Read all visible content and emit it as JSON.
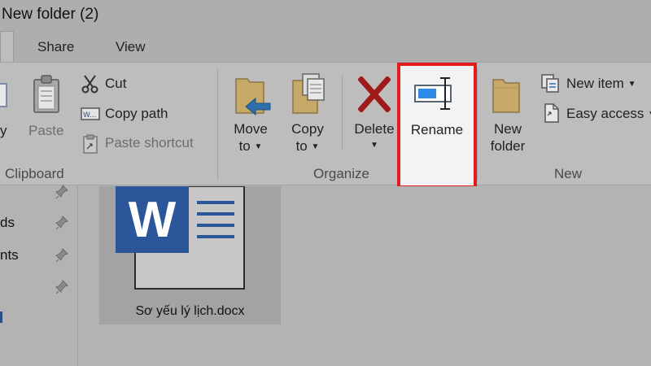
{
  "window": {
    "title": "New folder (2)"
  },
  "tabs": [
    {
      "label": "Share"
    },
    {
      "label": "View"
    }
  ],
  "ribbon": {
    "clipboard": {
      "group_label": "Clipboard",
      "partial_label": "y",
      "paste_label": "Paste",
      "cut_label": "Cut",
      "copy_path_label": "Copy path",
      "paste_shortcut_label": "Paste shortcut"
    },
    "organize": {
      "group_label": "Organize",
      "move_to": [
        "Move",
        "to"
      ],
      "copy_to": [
        "Copy",
        "to"
      ],
      "delete_label": "Delete",
      "rename_label": "Rename"
    },
    "new": {
      "group_label": "New",
      "new_folder": [
        "New",
        "folder"
      ],
      "new_item_label": "New item",
      "easy_access_label": "Easy access"
    }
  },
  "nav": {
    "items": [
      {
        "label": "ds"
      },
      {
        "label": "nts"
      }
    ]
  },
  "file": {
    "name": "Sơ yếu lý lịch.docx",
    "icon_letter": "W"
  },
  "colors": {
    "highlight": "#e11d1d",
    "word_blue": "#2b579a"
  }
}
